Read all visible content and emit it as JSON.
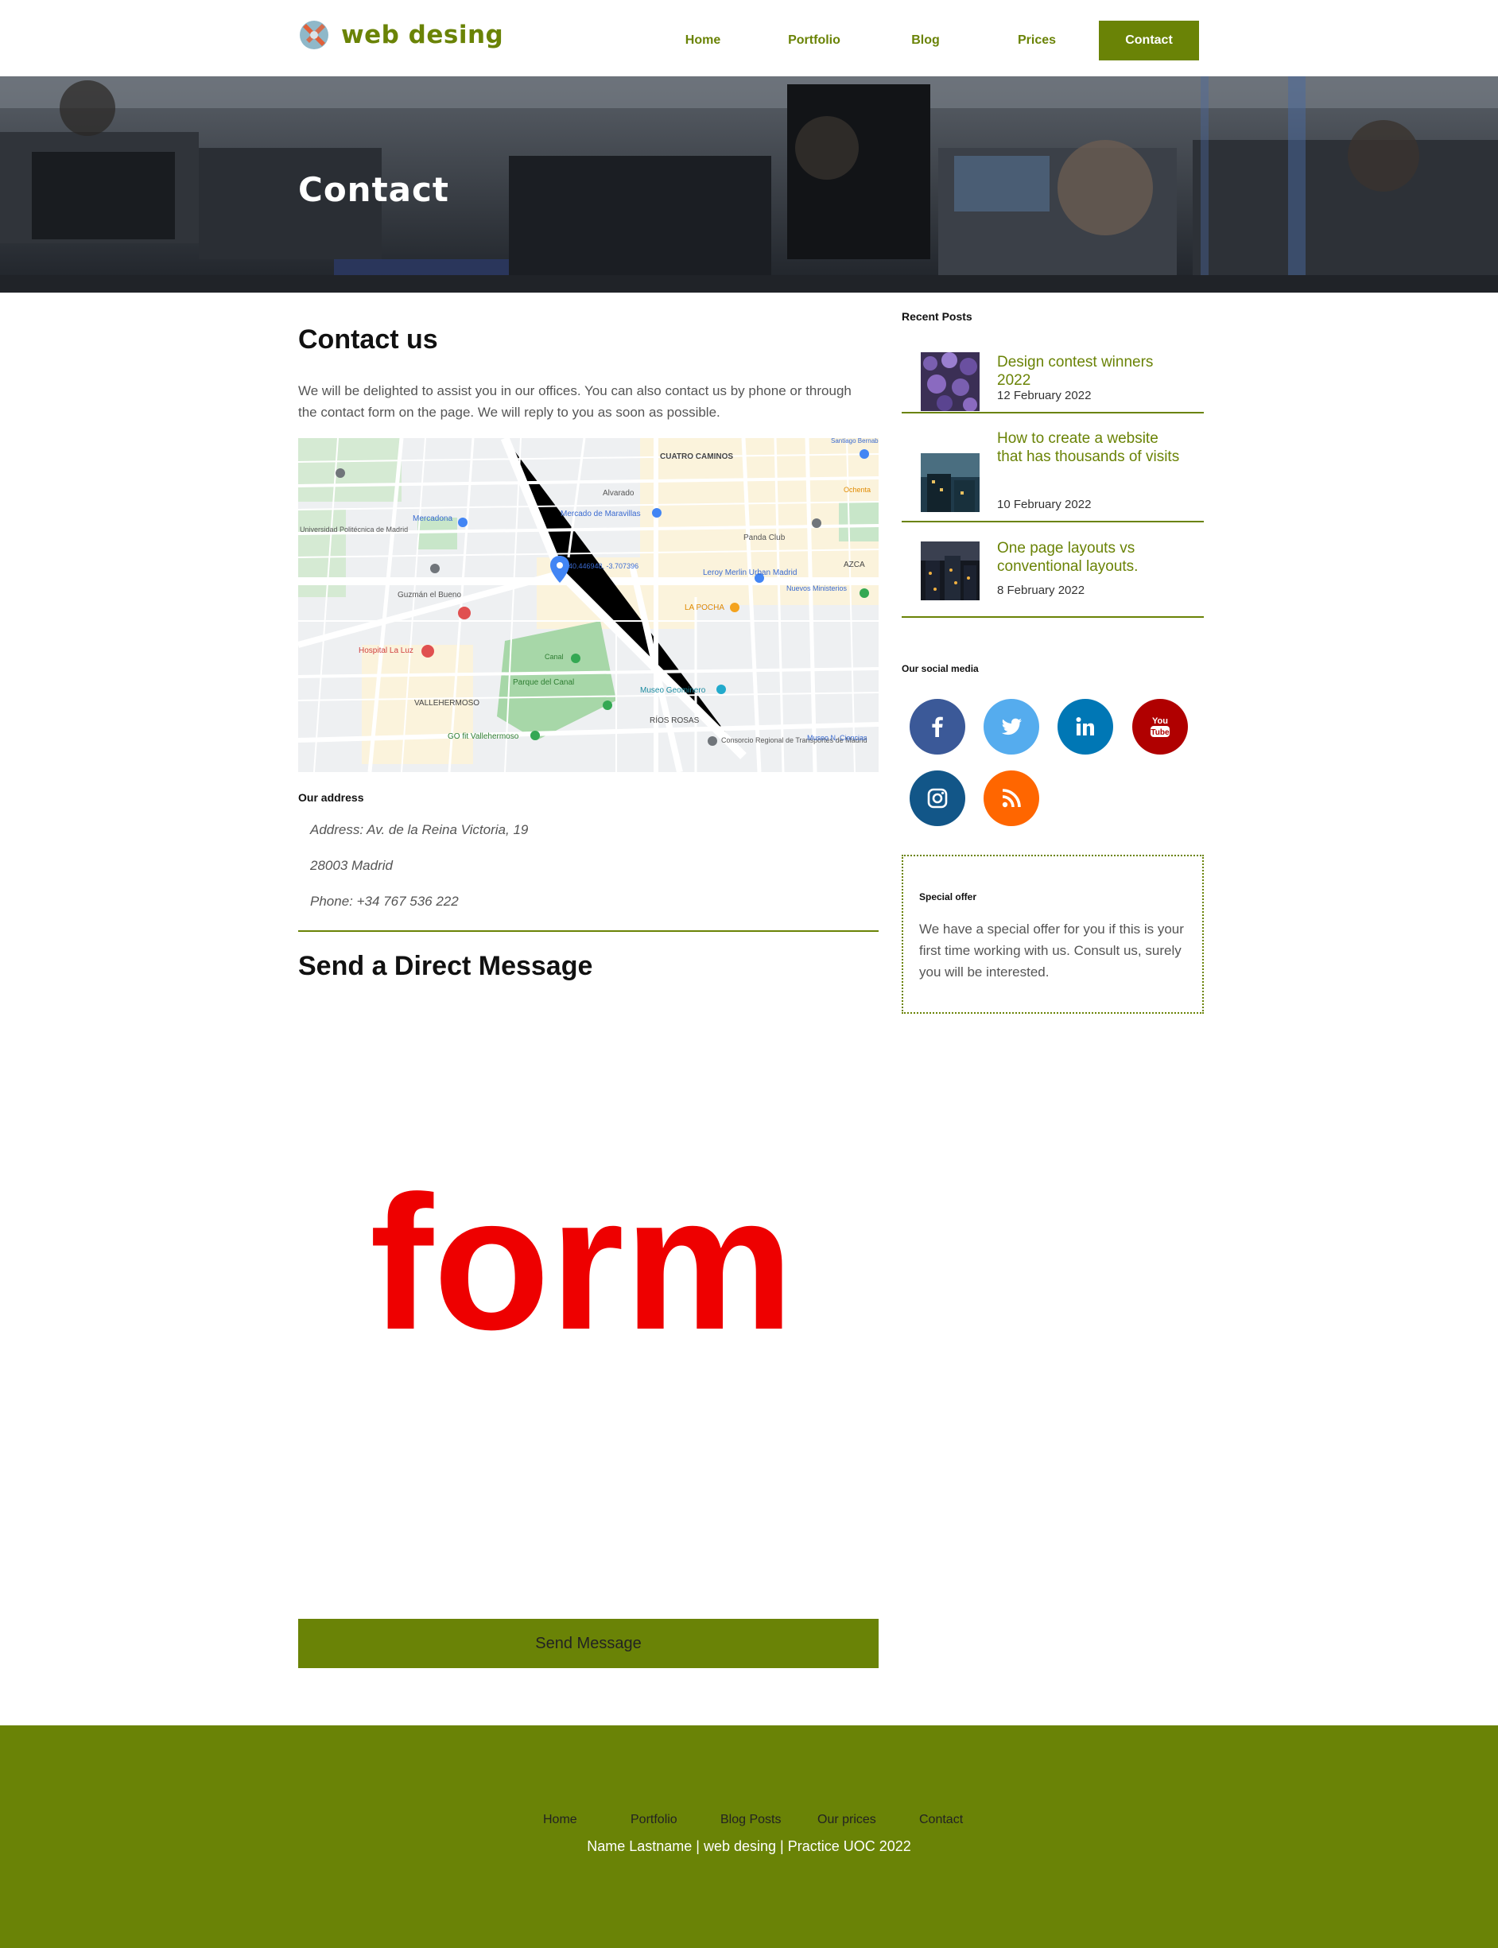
{
  "site": {
    "logo_text": "web desing"
  },
  "nav": {
    "items": [
      {
        "label": "Home"
      },
      {
        "label": "Portfolio"
      },
      {
        "label": "Blog"
      },
      {
        "label": "Prices"
      },
      {
        "label": "Contact"
      }
    ],
    "active_index": 4
  },
  "hero": {
    "title": "Contact"
  },
  "contact": {
    "heading": "Contact us",
    "intro": "We will be delighted to assist you in our offices. You can also contact us by phone or through the contact form on the page. We will reply to you as soon as possible.",
    "map": {
      "labels": [
        {
          "text": "CUATRO CAMINOS"
        },
        {
          "text": "Mercado de Maravillas"
        },
        {
          "text": "Mercadona"
        },
        {
          "text": "Alvarado"
        },
        {
          "text": "Panda Club"
        },
        {
          "text": "Nuevos Ministerios"
        },
        {
          "text": "AZCA"
        },
        {
          "text": "Leroy Merlin Urban Madrid"
        },
        {
          "text": "LA POCHA"
        },
        {
          "text": "Guzmán el Bueno"
        },
        {
          "text": "Hospital La Luz"
        },
        {
          "text": "VALLEHERMOSO"
        },
        {
          "text": "Parque del Canal"
        },
        {
          "text": "Museo Geominero"
        },
        {
          "text": "RÍOS ROSAS"
        },
        {
          "text": "Consorcio Regional de Transportes de Madrid"
        },
        {
          "text": "GO fit Vallehermoso"
        },
        {
          "text": "Universidad Politécnica de Madrid"
        },
        {
          "text": "40.446948, -3.707396"
        },
        {
          "text": "Museo N. Ciencias"
        },
        {
          "text": "Santiago Bernabéu"
        },
        {
          "text": "Ochenta"
        },
        {
          "text": "Canal"
        }
      ]
    },
    "address_title": "Our address",
    "address_lines": [
      "Address: Av. de la Reina Victoria, 19",
      "28003 Madrid",
      "Phone: +34 767 536 222"
    ],
    "send_heading": "Send a Direct Message",
    "form_placeholder": "form",
    "send_button": "Send Message"
  },
  "sidebar": {
    "recent_title": "Recent Posts",
    "posts": [
      {
        "title": "Design contest winners 2022",
        "date": "12 February 2022",
        "thumb": "purple-flowers"
      },
      {
        "title": "How to create a website that has thousands of visits",
        "date": "10 February 2022",
        "thumb": "dusk-building"
      },
      {
        "title": "One page layouts vs conventional layouts.",
        "date": "8 February 2022",
        "thumb": "night-city"
      }
    ],
    "social_title": "Our social media",
    "social": [
      {
        "name": "facebook-icon",
        "color": "#3b5998",
        "glyph": "f"
      },
      {
        "name": "twitter-icon",
        "color": "#55acee",
        "glyph": "t"
      },
      {
        "name": "linkedin-icon",
        "color": "#0077b5",
        "glyph": "in"
      },
      {
        "name": "youtube-icon",
        "color": "#b00000",
        "glyph": "You Tube"
      },
      {
        "name": "instagram-icon",
        "color": "#125688",
        "glyph": "ig"
      },
      {
        "name": "rss-icon",
        "color": "#ff6600",
        "glyph": "rss"
      }
    ],
    "offer_title": "Special offer",
    "offer_text": "We have a special offer for you if this is your first time working with us. Consult us, surely you will be interested."
  },
  "footer": {
    "links": [
      {
        "label": "Home"
      },
      {
        "label": "Portfolio"
      },
      {
        "label": "Blog Posts"
      },
      {
        "label": "Our prices"
      },
      {
        "label": "Contact"
      }
    ],
    "copyright": "Name Lastname | web desing | Practice UOC 2022"
  },
  "colors": {
    "brand": "#6a8306",
    "form_placeholder": "#ee0000"
  }
}
